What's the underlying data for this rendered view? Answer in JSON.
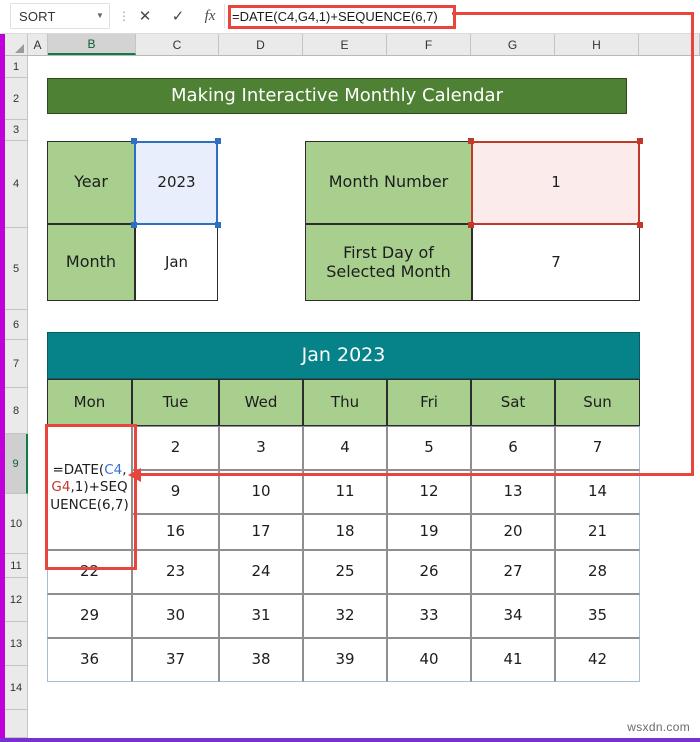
{
  "window": {
    "accent_edge_color": "#c000d8",
    "top_edge_color": "#6b2fd4"
  },
  "formula_bar": {
    "name_box_value": "SORT",
    "name_box_caret": "▼",
    "more_dots": "⋮",
    "cancel_icon": "✕",
    "enter_icon": "✓",
    "insert_function_icon": "fx",
    "formula": "=DATE(C4,G4,1)+SEQUENCE(6,7)"
  },
  "grid": {
    "columns": [
      "A",
      "B",
      "C",
      "D",
      "E",
      "F",
      "G",
      "H"
    ],
    "selected_column": "B",
    "rows": [
      "1",
      "2",
      "3",
      "4",
      "5",
      "6",
      "7",
      "8",
      "9",
      "10",
      "11",
      "12",
      "13",
      "14"
    ],
    "selected_row": "9"
  },
  "sheet": {
    "banner_title": "Making Interactive Monthly Calendar",
    "inputs_left": [
      {
        "label": "Year",
        "value": "2023",
        "state": "selected-blue"
      },
      {
        "label": "Month",
        "value": "Jan",
        "state": "plain"
      }
    ],
    "inputs_right": [
      {
        "label": "Month Number",
        "value": "1",
        "state": "selected-red"
      },
      {
        "label": "First Day of Selected Month",
        "value": "7",
        "state": "plain"
      }
    ],
    "calendar": {
      "title": "Jan 2023",
      "day_headers": [
        "Mon",
        "Tue",
        "Wed",
        "Thu",
        "Fri",
        "Sat",
        "Sun"
      ],
      "editing_cell": {
        "row": 0,
        "col": 0,
        "formula_parts": [
          {
            "text": "=DATE(",
            "style": "plain"
          },
          {
            "text": "C4",
            "style": "ref-blue"
          },
          {
            "text": ",",
            "style": "plain"
          },
          {
            "text": "G4",
            "style": "ref-red"
          },
          {
            "text": ",1)+SEQUENCE(6,7)",
            "style": "plain"
          }
        ]
      },
      "weeks": [
        [
          "",
          "2",
          "3",
          "4",
          "5",
          "6",
          "7"
        ],
        [
          "9",
          "10",
          "11",
          "12",
          "13",
          "14",
          ""
        ],
        [
          "16",
          "17",
          "18",
          "19",
          "20",
          "21",
          ""
        ],
        [
          "22",
          "23",
          "24",
          "25",
          "26",
          "27",
          "28"
        ],
        [
          "29",
          "30",
          "31",
          "32",
          "33",
          "34",
          "35"
        ],
        [
          "36",
          "37",
          "38",
          "39",
          "40",
          "41",
          "42"
        ]
      ],
      "weeks_full": [
        [
          "",
          "2",
          "3",
          "4",
          "5",
          "6",
          "7"
        ],
        [
          "",
          "9",
          "10",
          "11",
          "12",
          "13",
          "14"
        ],
        [
          "",
          "16",
          "17",
          "18",
          "19",
          "20",
          "21"
        ],
        [
          "22",
          "23",
          "24",
          "25",
          "26",
          "27",
          "28"
        ],
        [
          "29",
          "30",
          "31",
          "32",
          "33",
          "34",
          "35"
        ],
        [
          "36",
          "37",
          "38",
          "39",
          "40",
          "41",
          "42"
        ]
      ]
    }
  },
  "annotations": {
    "formula_bar_highlight_color": "#e8453c",
    "callout_arrow_color": "#e8453c",
    "edited_cell_highlight_color": "#e8453c"
  },
  "watermark": {
    "text": "wsxdn.com"
  },
  "colors": {
    "banner_green": "#4e8134",
    "label_green": "#a9cf8f",
    "calendar_teal": "#068289",
    "selection_blue": "#2f6fc2",
    "selection_red": "#c0392b"
  }
}
